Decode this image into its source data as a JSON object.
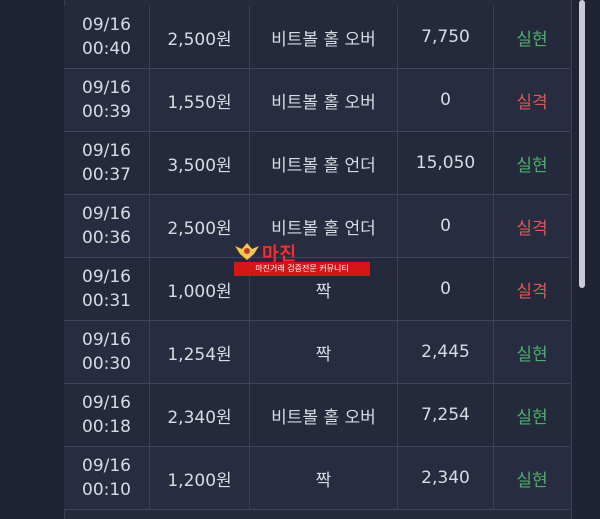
{
  "rows": [
    {
      "date": "09/16",
      "time": "00:40",
      "amount": "2,500원",
      "bet": "비트볼 홀 오버",
      "payout": "7,750",
      "result": "실현",
      "status": "win"
    },
    {
      "date": "09/16",
      "time": "00:39",
      "amount": "1,550원",
      "bet": "비트볼 홀 오버",
      "payout": "0",
      "result": "실격",
      "status": "lose"
    },
    {
      "date": "09/16",
      "time": "00:37",
      "amount": "3,500원",
      "bet": "비트볼 홀 언더",
      "payout": "15,050",
      "result": "실현",
      "status": "win"
    },
    {
      "date": "09/16",
      "time": "00:36",
      "amount": "2,500원",
      "bet": "비트볼 홀 언더",
      "payout": "0",
      "result": "실격",
      "status": "lose"
    },
    {
      "date": "09/16",
      "time": "00:31",
      "amount": "1,000원",
      "bet": "짝",
      "payout": "0",
      "result": "실격",
      "status": "lose"
    },
    {
      "date": "09/16",
      "time": "00:30",
      "amount": "1,254원",
      "bet": "짝",
      "payout": "2,445",
      "result": "실현",
      "status": "win"
    },
    {
      "date": "09/16",
      "time": "00:18",
      "amount": "2,340원",
      "bet": "비트볼 홀 오버",
      "payout": "7,254",
      "result": "실현",
      "status": "win"
    },
    {
      "date": "09/16",
      "time": "00:10",
      "amount": "1,200원",
      "bet": "짝",
      "payout": "2,340",
      "result": "실현",
      "status": "win"
    }
  ],
  "watermark": {
    "title": "마진",
    "subtitle": "마진거래 검증전문 커뮤니티"
  },
  "colors": {
    "background": "#1f2333",
    "row": "#252a3d",
    "grid": "#3f4560",
    "text": "#d9dbe3",
    "win": "#4caf6a",
    "lose": "#e05656",
    "watermark": "#ff2b2b"
  }
}
